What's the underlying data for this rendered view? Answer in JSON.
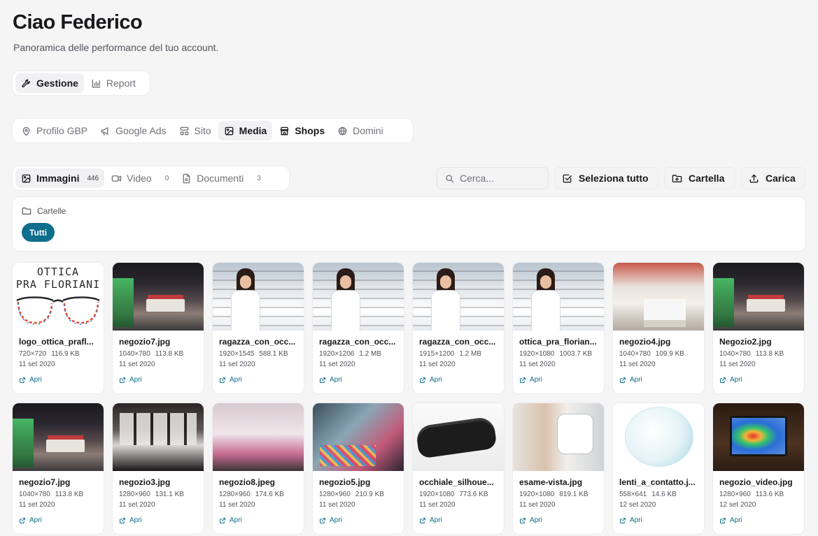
{
  "header": {
    "title": "Ciao Federico",
    "subtitle": "Panoramica delle performance del tuo account."
  },
  "mode_tabs": [
    {
      "label": "Gestione",
      "icon": "wrench-icon",
      "active": true
    },
    {
      "label": "Report",
      "icon": "bar-chart-icon",
      "active": false
    }
  ],
  "section_tabs": [
    {
      "label": "Profilo GBP",
      "icon": "map-pin-icon",
      "active": false
    },
    {
      "label": "Google Ads",
      "icon": "megaphone-icon",
      "active": false
    },
    {
      "label": "Sito",
      "icon": "layout-icon",
      "active": false
    },
    {
      "label": "Media",
      "icon": "image-icon",
      "active": true
    },
    {
      "label": "Shops",
      "icon": "store-icon",
      "active": false
    },
    {
      "label": "Domini",
      "icon": "globe-icon",
      "active": false
    }
  ],
  "media_tabs": [
    {
      "label": "Immagini",
      "count": "446",
      "icon": "image-icon",
      "active": true
    },
    {
      "label": "Video",
      "count": "0",
      "icon": "video-icon",
      "active": false
    },
    {
      "label": "Documenti",
      "count": "3",
      "icon": "file-icon",
      "active": false
    }
  ],
  "toolbar": {
    "search_placeholder": "Cerca...",
    "select_all_label": "Seleziona tutto",
    "folder_label": "Cartella",
    "upload_label": "Carica"
  },
  "folders": {
    "label": "Cartelle",
    "chip_label": "Tutti"
  },
  "open_label": "Apri",
  "images": [
    {
      "name": "logo_ottica_prafl...",
      "dims": "720×720",
      "size": "116.9 KB",
      "date": "11 set 2020",
      "thumb": "logo",
      "logo_line1": "OTTICA",
      "logo_line2": "PRA FLORIANI"
    },
    {
      "name": "negozio7.jpg",
      "dims": "1040×780",
      "size": "113.8 KB",
      "date": "11 set 2020",
      "thumb": "store"
    },
    {
      "name": "ragazza_con_occ...",
      "dims": "1920×1545",
      "size": "588.1 KB",
      "date": "11 set 2020",
      "thumb": "girl"
    },
    {
      "name": "ragazza_con_occ...",
      "dims": "1920×1206",
      "size": "1.2 MB",
      "date": "11 set 2020",
      "thumb": "girl"
    },
    {
      "name": "ragazza_con_occ...",
      "dims": "1915×1200",
      "size": "1.2 MB",
      "date": "11 set 2020",
      "thumb": "girl"
    },
    {
      "name": "ottica_pra_florian...",
      "dims": "1920×1080",
      "size": "1003.7 KB",
      "date": "11 set 2020",
      "thumb": "girl"
    },
    {
      "name": "negozio4.jpg",
      "dims": "1040×780",
      "size": "109.9 KB",
      "date": "11 set 2020",
      "thumb": "counter"
    },
    {
      "name": "Negozio2.jpg",
      "dims": "1040×780",
      "size": "113.8 KB",
      "date": "11 set 2020",
      "thumb": "store"
    },
    {
      "name": "negozio7.jpg",
      "dims": "1040×780",
      "size": "113.8 KB",
      "date": "11 set 2020",
      "thumb": "store"
    },
    {
      "name": "negozio3.jpg",
      "dims": "1280×960",
      "size": "131.1 KB",
      "date": "11 set 2020",
      "thumb": "dark"
    },
    {
      "name": "negozio8.jpeg",
      "dims": "1280×960",
      "size": "174.6 KB",
      "date": "11 set 2020",
      "thumb": "pink"
    },
    {
      "name": "negozio5.jpg",
      "dims": "1280×960",
      "size": "210.9 KB",
      "date": "11 set 2020",
      "thumb": "window"
    },
    {
      "name": "occhiale_silhoue...",
      "dims": "1920×1080",
      "size": "773.6 KB",
      "date": "11 set 2020",
      "thumb": "case"
    },
    {
      "name": "esame-vista.jpg",
      "dims": "1920×1080",
      "size": "819.1 KB",
      "date": "11 set 2020",
      "thumb": "exam"
    },
    {
      "name": "lenti_a_contatto.j...",
      "dims": "558×641",
      "size": "14.6 KB",
      "date": "12 set 2020",
      "thumb": "lens"
    },
    {
      "name": "negozio_video.jpg",
      "dims": "1280×960",
      "size": "113.6 KB",
      "date": "12 set 2020",
      "thumb": "screen"
    }
  ]
}
